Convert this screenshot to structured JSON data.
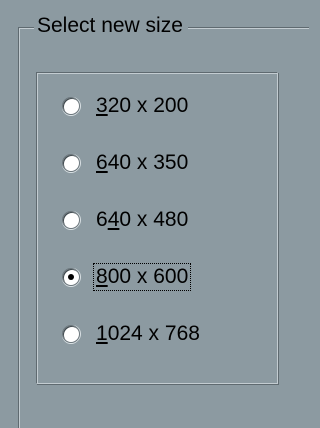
{
  "group": {
    "title": "Select new size"
  },
  "options": [
    {
      "label": "320 x 200",
      "mnemonic": "3",
      "selected": false
    },
    {
      "label": "640 x 350",
      "mnemonic": "6",
      "selected": false
    },
    {
      "label": "640 x 480",
      "mnemonic": "4",
      "selected": false
    },
    {
      "label": "800 x 600",
      "mnemonic": "8",
      "selected": true
    },
    {
      "label": "1024 x 768",
      "mnemonic": "1",
      "selected": false
    }
  ]
}
